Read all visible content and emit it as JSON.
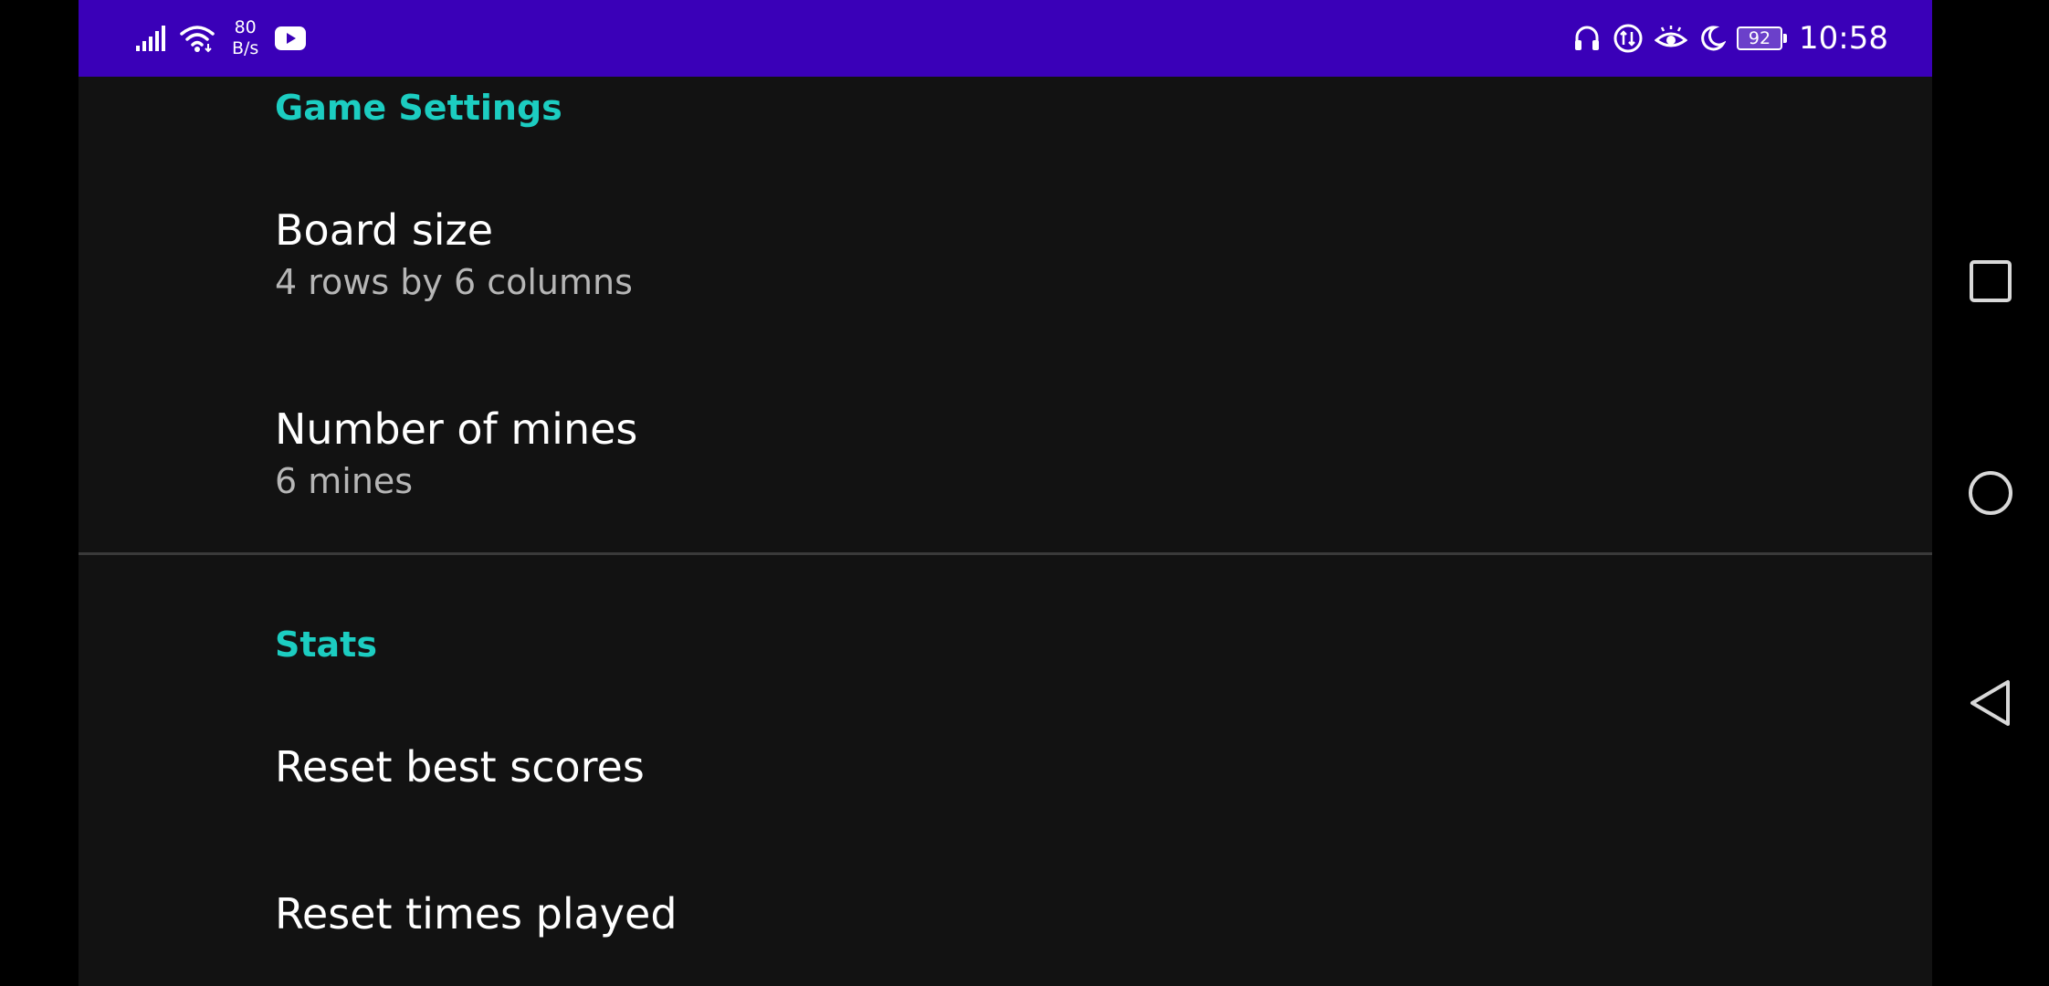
{
  "status_bar": {
    "net_speed_value": "80",
    "net_speed_unit": "B/s",
    "battery_level": "92",
    "time": "10:58",
    "bar_color": "#3a00b8"
  },
  "settings": {
    "game_category": "Game Settings",
    "board_size_title": "Board size",
    "board_size_summary": "4 rows by 6 columns",
    "mines_title": "Number of mines",
    "mines_summary": "6 mines",
    "stats_category": "Stats",
    "reset_best_title": "Reset best scores",
    "reset_times_title": "Reset times played",
    "accent_color": "#1ccdc1"
  },
  "icons": {
    "status_left": [
      "signal-icon",
      "wifi-icon",
      "youtube-icon"
    ],
    "status_right": [
      "headset-icon",
      "data-saver-icon",
      "eye-comfort-icon",
      "moon-icon",
      "battery-icon"
    ],
    "navigation": [
      "recents-square-icon",
      "home-circle-icon",
      "back-triangle-icon"
    ]
  }
}
